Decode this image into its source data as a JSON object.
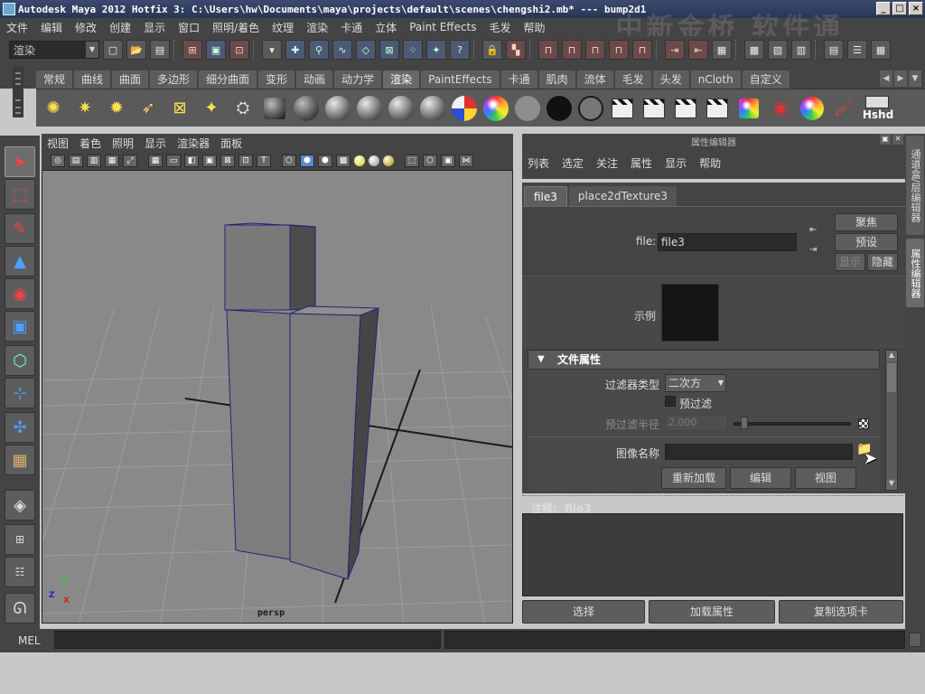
{
  "window": {
    "title": "Autodesk Maya 2012 Hotfix 3: C:\\Users\\hw\\Documents\\maya\\projects\\default\\scenes\\chengshi2.mb*   ---   bump2d1",
    "controls": [
      "_",
      "□",
      "×"
    ]
  },
  "menubar": {
    "items": [
      "文件",
      "编辑",
      "修改",
      "创建",
      "显示",
      "窗口",
      "照明/着色",
      "纹理",
      "渲染",
      "卡通",
      "立体",
      "Paint Effects",
      "毛发",
      "帮助"
    ],
    "watermark": "中新金桥 软件通"
  },
  "statusline": {
    "mode": "渲染"
  },
  "shelf": {
    "tabs": [
      "常规",
      "曲线",
      "曲面",
      "多边形",
      "细分曲面",
      "变形",
      "动画",
      "动力学",
      "渲染",
      "PaintEffects",
      "卡通",
      "肌肉",
      "流体",
      "毛发",
      "头发",
      "nCloth",
      "自定义"
    ],
    "active_tab": "渲染",
    "last_icon_label": "Hshd"
  },
  "viewport": {
    "menu": [
      "视图",
      "着色",
      "照明",
      "显示",
      "渲染器",
      "面板"
    ],
    "camera_label": "persp",
    "axis_labels": [
      "Y",
      "Z",
      "X"
    ]
  },
  "attribute_editor": {
    "panel_title": "属性编辑器",
    "menu": [
      "列表",
      "选定",
      "关注",
      "属性",
      "显示",
      "帮助"
    ],
    "tabs": [
      "file3",
      "place2dTexture3"
    ],
    "active_tab": "file3",
    "node_label": "file:",
    "node_name": "file3",
    "buttons": {
      "focus": "聚焦",
      "presets": "预设",
      "show": "显示",
      "hide": "隐藏"
    },
    "sample_label": "示例",
    "section_title": "文件属性",
    "filter_type_label": "过滤器类型",
    "filter_type_value": "二次方",
    "prefilter_label": "预过滤",
    "prefilter_radius_label": "预过滤半径",
    "prefilter_radius_value": "2.000",
    "image_name_label": "图像名称",
    "image_name_value": "",
    "section_buttons": [
      "重新加载",
      "编辑",
      "视图"
    ],
    "notes_label": "注释:",
    "notes_node": "file3",
    "notes_text": "",
    "bottom_buttons": [
      "选择",
      "加载属性",
      "复制选项卡"
    ]
  },
  "side_tabs": [
    "通道盒/层编辑器",
    "属性编辑器"
  ],
  "command_line": {
    "language": "MEL",
    "input": "",
    "result": ""
  },
  "colors": {
    "panel_bg": "#444444",
    "viewport_bg": "#898989",
    "title_bar": "#2a3656",
    "cube_face_front": "#7a7a7a",
    "cube_face_side": "#4a4a4a",
    "cube_edge": "#2a2a7a"
  }
}
